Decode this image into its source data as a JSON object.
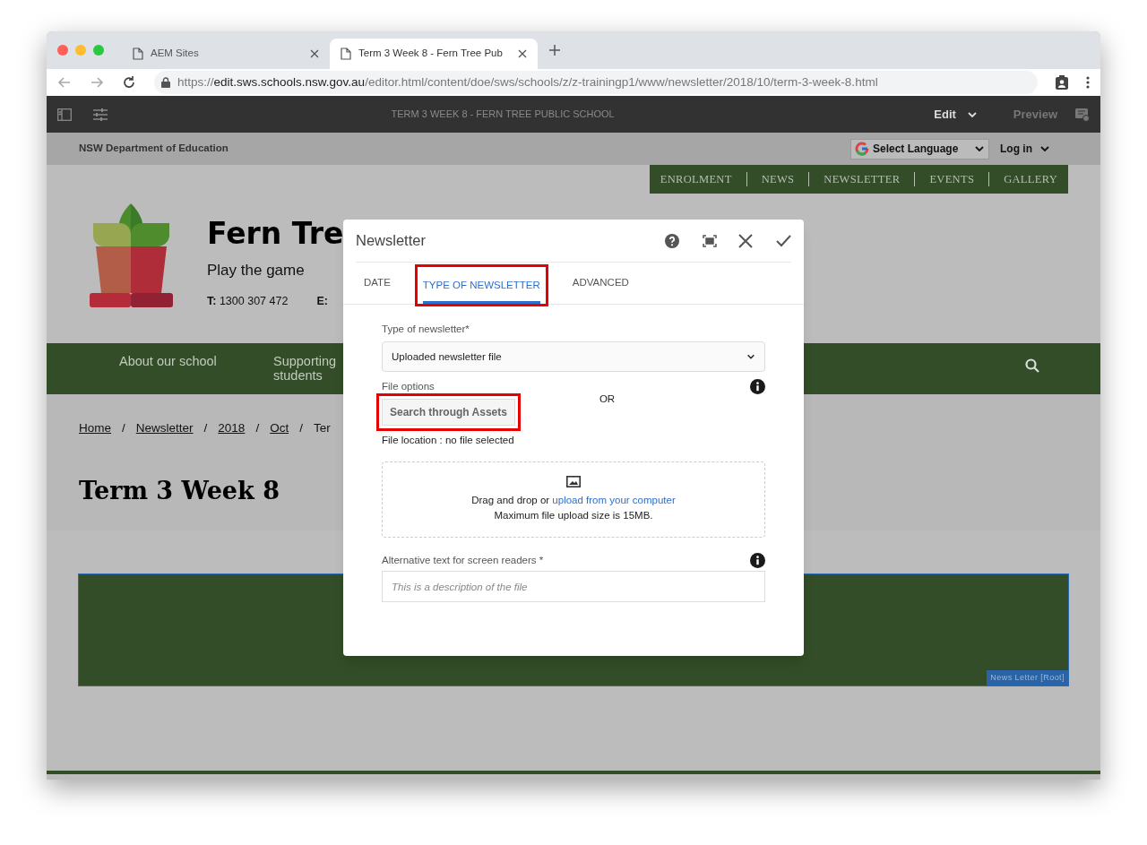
{
  "browser": {
    "tabs": [
      {
        "title": "AEM Sites",
        "selected": false
      },
      {
        "title": "Term 3 Week 8 - Fern Tree Pub",
        "selected": true
      }
    ],
    "url": {
      "host_prefix": "https://",
      "host": "edit.sws.schools.nsw.gov.au",
      "path": "/editor.html/content/doe/sws/schools/z/z-trainingp1/www/newsletter/2018/10/term-3-week-8.html"
    }
  },
  "editor_toolbar": {
    "page_title": "TERM 3 WEEK 8 - FERN TREE PUBLIC SCHOOL",
    "mode": "Edit",
    "preview": "Preview"
  },
  "site": {
    "department": "NSW Department of Education",
    "language": "Select Language",
    "login": "Log in",
    "top_nav": [
      "ENROLMENT",
      "NEWS",
      "NEWSLETTER",
      "EVENTS",
      "GALLERY"
    ],
    "school_name": "Fern Tre",
    "motto": "Play the game",
    "phone_label": "T:",
    "phone": "1300 307 472",
    "email_label": "E:",
    "main_nav": [
      "About our school",
      "Supporting students"
    ],
    "breadcrumb": [
      {
        "kind": "link",
        "label": "Home"
      },
      {
        "kind": "separator",
        "label": "/"
      },
      {
        "kind": "link",
        "label": "Newsletter"
      },
      {
        "kind": "separator",
        "label": "/"
      },
      {
        "kind": "link",
        "label": "2018"
      },
      {
        "kind": "separator",
        "label": "/"
      },
      {
        "kind": "link",
        "label": "Oct"
      },
      {
        "kind": "separator",
        "label": "/"
      },
      {
        "kind": "current",
        "label": "Ter"
      }
    ],
    "page_heading": "Term 3 Week 8",
    "component_badge": "News Letter [Root]"
  },
  "dialog": {
    "title": "Newsletter",
    "tabs": [
      {
        "label": "DATE",
        "selected": false
      },
      {
        "label": "TYPE OF NEWSLETTER",
        "selected": true,
        "highlighted": true
      },
      {
        "label": "ADVANCED",
        "selected": false
      }
    ],
    "type_label": "Type of newsletter*",
    "type_value": "Uploaded newsletter file",
    "file_options_label": "File options",
    "search_button": {
      "label": "Search through Assets",
      "highlighted": true
    },
    "or": "OR",
    "file_location": "File location : no file selected",
    "dropzone": {
      "text": "Drag and drop or",
      "link": "upload from your computer",
      "limit": "Maximum file upload size is 15MB."
    },
    "alt_label": "Alternative text for screen readers *",
    "alt_placeholder": "This is a description of the file"
  }
}
